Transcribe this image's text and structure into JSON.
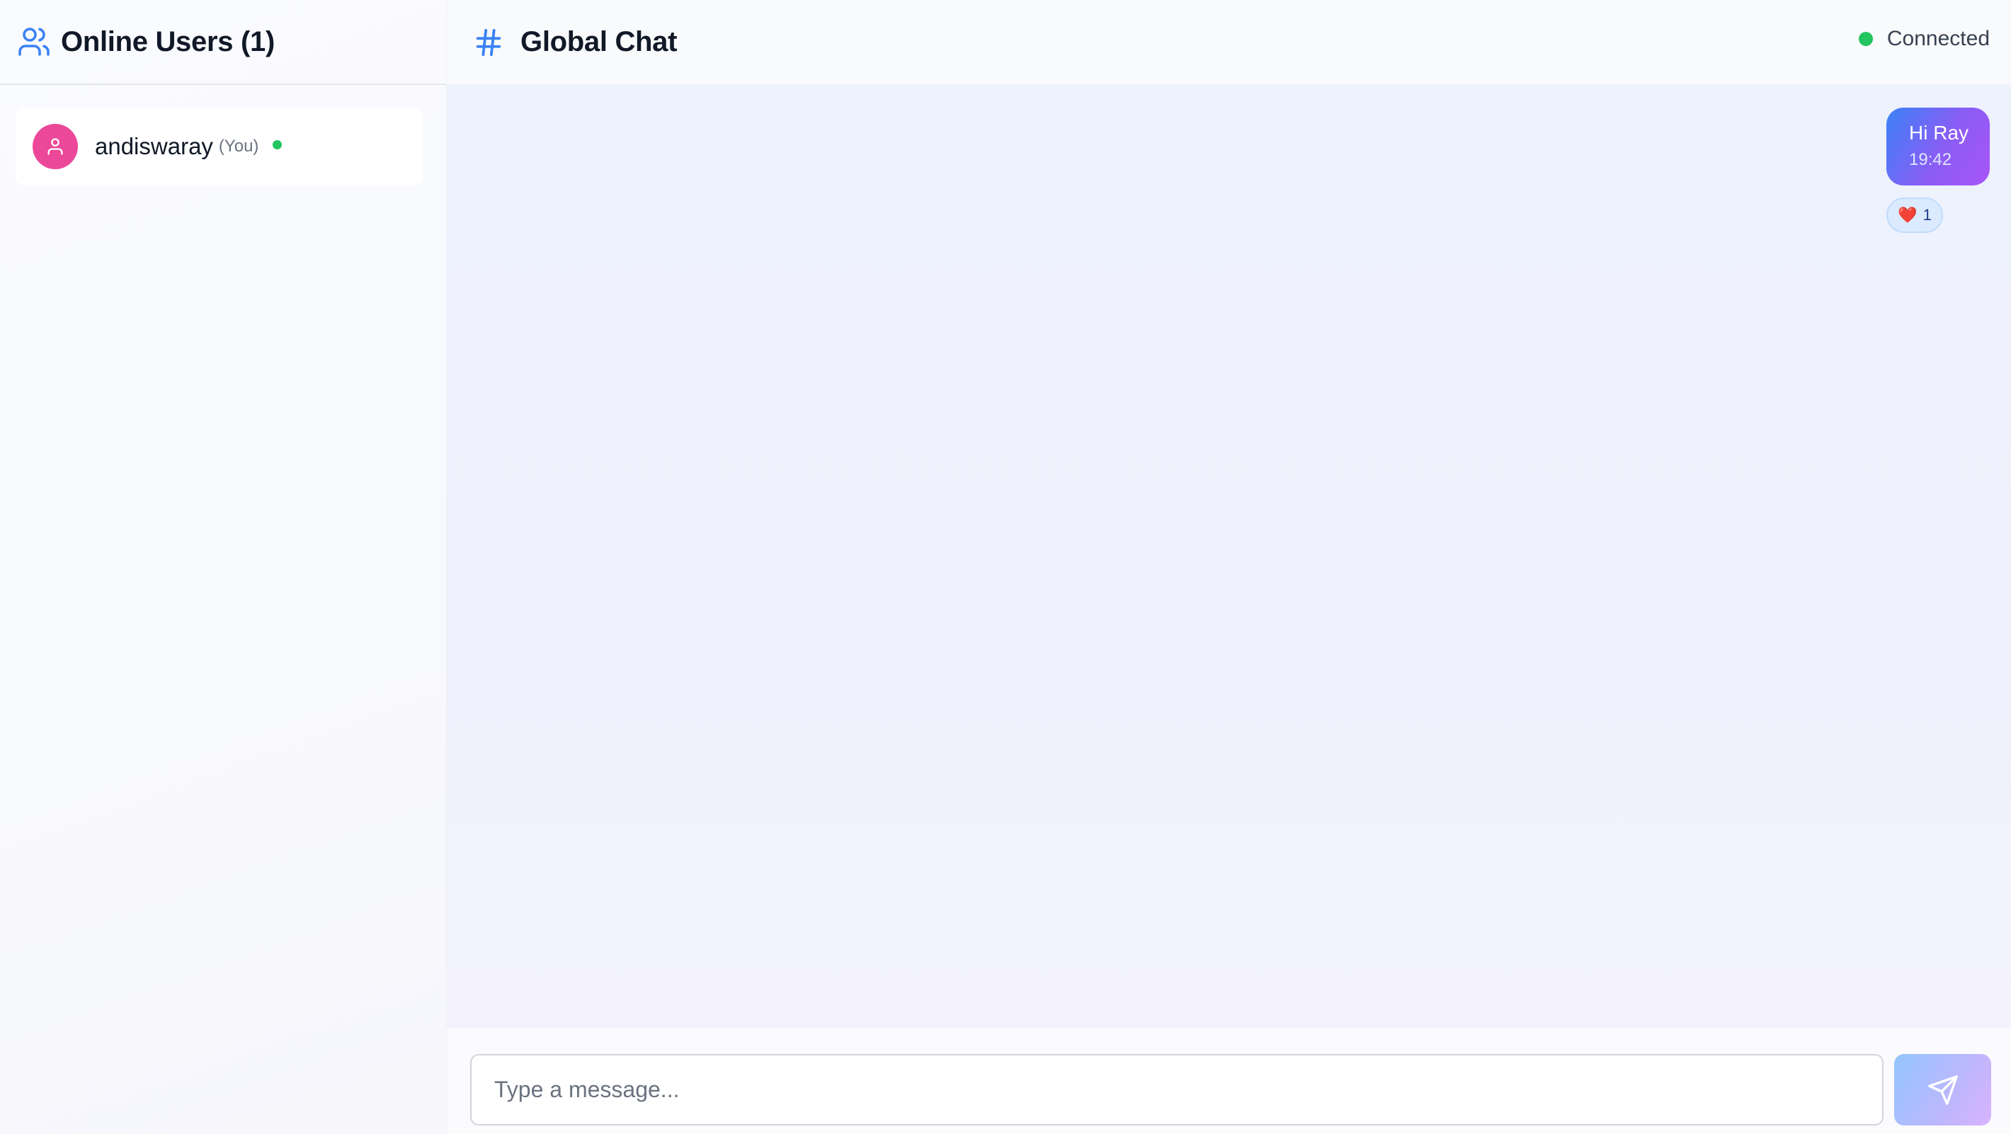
{
  "sidebar": {
    "title": "Online Users (1)",
    "title_icon": "users-icon",
    "users": [
      {
        "name": "andiswaray",
        "tag": "(You)",
        "status": "online",
        "avatar_icon": "user-icon",
        "avatar_color": "#ec4899"
      }
    ]
  },
  "chat": {
    "title": "Global Chat",
    "title_icon": "hash-icon",
    "connection_status": "Connected",
    "connection_color": "#22c55e",
    "messages": [
      {
        "text": "Hi Ray",
        "time": "19:42",
        "own": true,
        "reactions": [
          {
            "emoji": "❤️",
            "count": "1"
          }
        ]
      }
    ]
  },
  "composer": {
    "placeholder": "Type a message...",
    "value": "",
    "send_icon": "send-icon"
  },
  "colors": {
    "accent_blue": "#3b82f6",
    "accent_purple": "#a855f7",
    "online_green": "#22c55e"
  }
}
